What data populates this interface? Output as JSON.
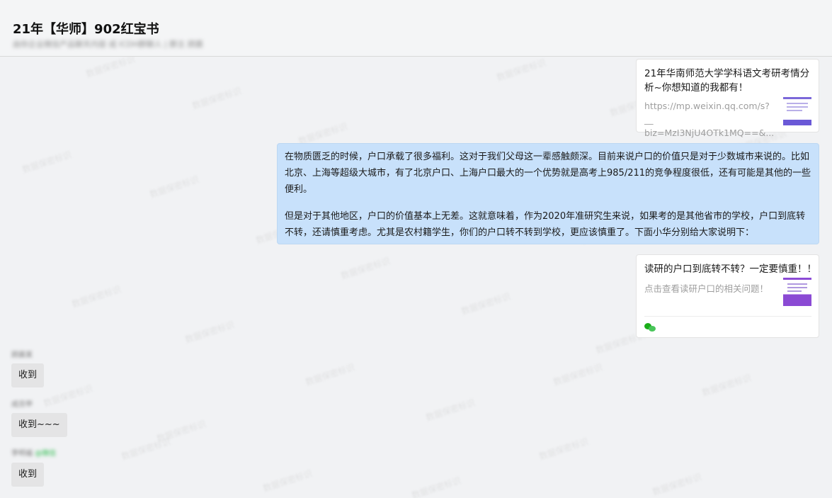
{
  "header": {
    "title": "21年【华师】902红宝书",
    "subtitle": "由你企业微信产品聊天内容 成 ICDH群聊人 | 群主 顾晨"
  },
  "watermark_text": "数据保密标识",
  "messages": {
    "card1": {
      "title": "21年华南师范大学学科语文考研考情分析~你想知道的我都有！",
      "desc": "https://mp.weixin.qq.com/s?__\nbiz=MzI3NjU4OTk1MQ==&..."
    },
    "outgoing_text": {
      "paragraph1": "在物质匮乏的时候，户口承载了很多福利。这对于我们父母这一辈感触颇深。目前来说户口的价值只是对于少数城市来说的。比如北京、上海等超级大城市，有了北京户口、上海户口最大的一个优势就是高考上985/211的竞争程度很低，还有可能是其他的一些便利。",
      "paragraph2": "但是对于其他地区，户口的价值基本上无差。这就意味着，作为2020年准研究生来说，如果考的是其他省市的学校，户口到底转不转，还请慎重考虑。尤其是农村籍学生，你们的户口转不转到学校，更应该慎重了。下面小华分别给大家说明下："
    },
    "card2": {
      "title": "读研的户口到底转不转？一定要慎重！！",
      "desc": "点击查看读研户口的相关问题！",
      "source_icon": "wechat-icon"
    },
    "incoming": [
      {
        "sender": "顾晨某",
        "text": "收到"
      },
      {
        "sender": "成员甲",
        "text": "收到~~~"
      },
      {
        "sender": "李明福",
        "badge": "@微信",
        "text": "收到"
      }
    ]
  },
  "colors": {
    "background": "#f1f2f4",
    "outgoing_bubble": "#c8e1fb",
    "incoming_bubble": "#e4e4e5",
    "card_bg": "#ffffff",
    "wechat_green": "#1aad19"
  }
}
